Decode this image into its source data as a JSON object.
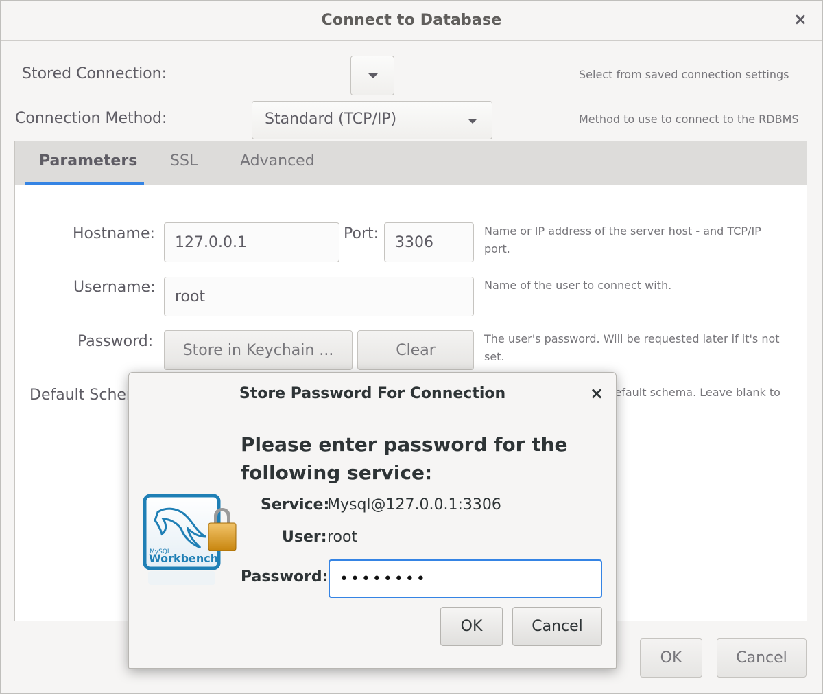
{
  "window": {
    "title": "Connect to Database",
    "close_glyph": "×"
  },
  "stored_connection": {
    "label": "Stored Connection:",
    "value": "",
    "hint": "Select from saved connection settings"
  },
  "connection_method": {
    "label": "Connection Method:",
    "value": "Standard (TCP/IP)",
    "hint": "Method to use to connect to the RDBMS"
  },
  "tabs": [
    {
      "label": "Parameters",
      "active": true
    },
    {
      "label": "SSL",
      "active": false
    },
    {
      "label": "Advanced",
      "active": false
    }
  ],
  "parameters": {
    "hostname_label": "Hostname:",
    "hostname_value": "127.0.0.1",
    "port_label": "Port:",
    "port_value": "3306",
    "host_hint_line1": "Name or IP address of the server host - and TCP/IP",
    "host_hint_line2": "port.",
    "username_label": "Username:",
    "username_value": "root",
    "username_hint": "Name of the user to connect with.",
    "password_label": "Password:",
    "store_keychain_label": "Store in Keychain ...",
    "clear_label": "Clear",
    "password_hint_line1": "The user's password. Will be requested later if it's not",
    "password_hint_line2": "set.",
    "default_schema_label": "Default Schema:",
    "default_schema_hint": "The schema to use as default schema. Leave blank to"
  },
  "footer": {
    "ok_label": "OK",
    "cancel_label": "Cancel"
  },
  "modal": {
    "title": "Store Password For Connection",
    "close_glyph": "×",
    "heading_line1": "Please enter password for the",
    "heading_line2": "following service:",
    "service_label": "Service:",
    "service_value": "Mysql@127.0.0.1:3306",
    "user_label": "User:",
    "user_value": "root",
    "password_label": "Password:",
    "password_value": "••••••••",
    "ok_label": "OK",
    "cancel_label": "Cancel",
    "logo_text_top": "MySQL",
    "logo_text_main": "Workbench"
  },
  "colors": {
    "accent": "#3584e4",
    "logo_blue": "#1f7fb5"
  }
}
